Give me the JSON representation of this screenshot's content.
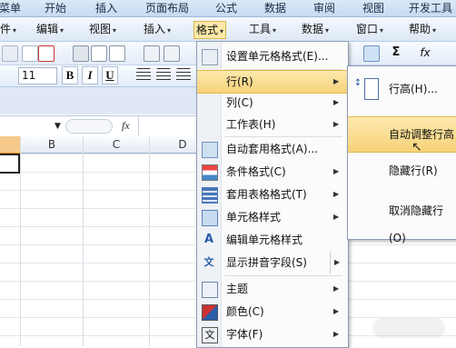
{
  "ribbon_tabs": [
    "菜单",
    "开始",
    "插入",
    "页面布局",
    "公式",
    "数据",
    "审阅",
    "视图",
    "开发工具"
  ],
  "menu_bar": {
    "items": [
      "件",
      "编辑",
      "视图",
      "插入",
      "格式",
      "工具",
      "数据",
      "窗口",
      "帮助"
    ],
    "active": "格式"
  },
  "font_size": "11",
  "format_buttons": {
    "bold": "B",
    "italic": "I",
    "underline": "U"
  },
  "formula_bar": {
    "fx_label": "fx"
  },
  "column_headers": [
    "B",
    "C",
    "D"
  ],
  "format_menu": {
    "items": [
      {
        "label": "设置单元格格式(E)...",
        "icon": "cell-format-icon",
        "submenu": false
      },
      {
        "label": "行(R)",
        "icon": "",
        "submenu": true,
        "highlighted": true
      },
      {
        "label": "列(C)",
        "icon": "",
        "submenu": true
      },
      {
        "label": "工作表(H)",
        "icon": "",
        "submenu": true
      },
      {
        "label": "自动套用格式(A)...",
        "icon": "autoformat-icon",
        "submenu": false
      },
      {
        "label": "条件格式(C)",
        "icon": "conditional-format-icon",
        "submenu": true
      },
      {
        "label": "套用表格格式(T)",
        "icon": "table-format-icon",
        "submenu": true
      },
      {
        "label": "单元格样式",
        "icon": "cell-style-icon",
        "submenu": true
      },
      {
        "label": "编辑单元格样式",
        "icon": "edit-style-icon",
        "submenu": false
      },
      {
        "label": "显示拼音字段(S)",
        "icon": "phonetic-icon",
        "submenu": true
      },
      {
        "label": "主题",
        "icon": "theme-icon",
        "submenu": true
      },
      {
        "label": "颜色(C)",
        "icon": "color-icon",
        "submenu": true
      },
      {
        "label": "字体(F)",
        "icon": "font-icon",
        "submenu": true
      }
    ]
  },
  "row_submenu": {
    "items": [
      {
        "label": "行高(H)...",
        "icon": "row-height-icon"
      },
      {
        "label": "自动调整行高",
        "highlighted": true
      },
      {
        "label": "隐藏行(R)"
      },
      {
        "label": "取消隐藏行(O)"
      }
    ]
  },
  "accent_colors": {
    "highlight": "#f6d27a",
    "menu_border": "#8d9db5",
    "ribbon": "#c7daf2"
  }
}
